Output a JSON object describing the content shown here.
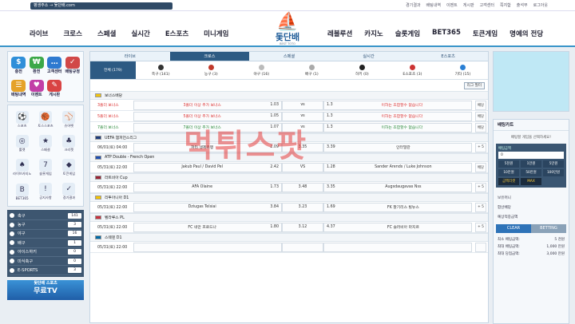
{
  "address": "평생주소 → 돛단배.com",
  "toplinks": [
    "경기결과",
    "배팅내역",
    "이벤트",
    "게시판",
    "고객센터",
    "쪽지함",
    "출석부",
    "로그아웃"
  ],
  "nav_left": [
    "라이브",
    "크로스",
    "스페셜",
    "실시간",
    "E스포츠",
    "미니게임"
  ],
  "nav_right": [
    "레블루션",
    "카지노",
    "슬롯게임",
    "BET365",
    "토큰게임",
    "명예의 전당"
  ],
  "logo": {
    "title": "돛단배",
    "sub": "BEST TOTO"
  },
  "quick": [
    {
      "label": "충전",
      "icon": "$",
      "color": "#2f8fd9"
    },
    {
      "label": "환전",
      "icon": "₩",
      "color": "#3ca848"
    },
    {
      "label": "고객센터",
      "icon": "…",
      "color": "#2f7ad0"
    },
    {
      "label": "배팅규정",
      "icon": "✓",
      "color": "#d14848"
    },
    {
      "label": "배팅내역",
      "icon": "☰",
      "color": "#e5a229"
    },
    {
      "label": "이벤트",
      "icon": "♥",
      "color": "#c23fa7"
    },
    {
      "label": "게시판",
      "icon": "✎",
      "color": "#d94444"
    }
  ],
  "sport_icons": [
    {
      "label": "스포츠",
      "icon": "⚽"
    },
    {
      "label": "토스스포츠",
      "icon": "🏀"
    },
    {
      "label": "슈어벳",
      "icon": "⚾"
    },
    {
      "label": "룰렛",
      "icon": "◎"
    },
    {
      "label": "스페셜",
      "icon": "★"
    },
    {
      "label": "크리켓",
      "icon": "♣"
    },
    {
      "label": "라이브카지노",
      "icon": "♠"
    },
    {
      "label": "슬롯게임",
      "icon": "7"
    },
    {
      "label": "토큰게임",
      "icon": "◆"
    },
    {
      "label": "BET365",
      "icon": "B"
    },
    {
      "label": "공지사항",
      "icon": "!"
    },
    {
      "label": "경기결과",
      "icon": "✓"
    }
  ],
  "counts": [
    {
      "name": "축구",
      "n": "141"
    },
    {
      "name": "농구",
      "n": "3"
    },
    {
      "name": "야구",
      "n": "16"
    },
    {
      "name": "배구",
      "n": "1"
    },
    {
      "name": "아이스하키",
      "n": "0"
    },
    {
      "name": "미식축구",
      "n": "0"
    },
    {
      "name": "E-SPORTS",
      "n": "3"
    }
  ],
  "banner": {
    "top": "돛단배 스포츠",
    "main": "무료TV"
  },
  "tabs": [
    "라이브",
    "크로스",
    "스페셜",
    "실시간",
    "E스포츠"
  ],
  "sports": [
    {
      "label": "전체 (179)",
      "color": "#fff"
    },
    {
      "label": "축구 (141)",
      "color": "#333"
    },
    {
      "label": "농구 (3)",
      "color": "#c0392b"
    },
    {
      "label": "야구 (16)",
      "color": "#bbb"
    },
    {
      "label": "배구 (1)",
      "color": "#aaa"
    },
    {
      "label": "하키 (0)",
      "color": "#222"
    },
    {
      "label": "E스포츠 (3)",
      "color": "#c33"
    },
    {
      "label": "기타 (15)",
      "color": "#2a7fd4"
    }
  ],
  "filter_label": "리그 필터",
  "sections": [
    {
      "league": "보너스배당",
      "flag": "#f1c40f",
      "rows": [
        {
          "time": "3폴더 보너스",
          "home": "3폴더 이상 추가 보너스",
          "ho": "1.03",
          "mid": "vs",
          "ao": "1.3",
          "away": "이하는 조합할수 없습니다",
          "x": "배당",
          "red": true
        },
        {
          "time": "5폴더 보너스",
          "home": "5폴더 이상 추가 보너스",
          "ho": "1.05",
          "mid": "vs",
          "ao": "1.3",
          "away": "이하는 조합할수 없습니다",
          "x": "배당",
          "red": true
        },
        {
          "time": "7폴더 보너스",
          "home": "7폴더 이상 추가 보너스",
          "ho": "1.07",
          "mid": "vs",
          "ao": "1.3",
          "away": "이하는 조합할수 없습니다",
          "x": "배당",
          "green": true
        }
      ]
    },
    {
      "league": "UEFA 챔피언스리그",
      "flag": "#1f3d7a",
      "rows": [
        {
          "time": "06/01(토) 04:00",
          "home": "파리 생제르맹",
          "ho": "2.09",
          "mid": "3.35",
          "ao": "3.39",
          "away": "인터밀란",
          "x": "+ 5"
        }
      ]
    },
    {
      "league": "ATP Double - French Open",
      "flag": "#1f4fb0",
      "rows": [
        {
          "time": "05/31(토) 22:00",
          "home": "Jakub Paul / David Pel",
          "ho": "2.42",
          "mid": "VS",
          "ao": "1.28",
          "away": "Sander Arends / Luke Johnson",
          "x": "배당"
        }
      ]
    },
    {
      "league": "라트비아 Cup",
      "flag": "#9b2335",
      "rows": [
        {
          "time": "05/31(토) 22:00",
          "home": "AFA Olaine",
          "ho": "1.73",
          "mid": "3.48",
          "ao": "3.35",
          "away": "Augsdaugavas Nss",
          "x": "+ 5"
        }
      ]
    },
    {
      "league": "리투아니아 D1",
      "flag": "#f4c300",
      "rows": [
        {
          "time": "05/31(토) 22:00",
          "home": "Dziugas Telsiai",
          "ho": "3.84",
          "mid": "3.23",
          "ao": "1.69",
          "away": "FK 잘기리스 빌뉴스",
          "x": "+ 5"
        }
      ]
    },
    {
      "league": "벨라루스 PL",
      "flag": "#c8313e",
      "rows": [
        {
          "time": "05/31(토) 22:00",
          "home": "FC 네만 흐로드나",
          "ho": "1.80",
          "mid": "3.12",
          "ao": "4.37",
          "away": "FC 슬러비아 마지르",
          "x": "+ 5"
        }
      ]
    },
    {
      "league": "스웨덴 D1",
      "flag": "#006aa7",
      "rows": [
        {
          "time": "05/31(토) 22:00",
          "home": "",
          "ho": "",
          "mid": "",
          "ao": "",
          "away": "",
          "x": ""
        }
      ]
    }
  ],
  "cart": {
    "title": "배팅카트",
    "message": "배팅할 게임을 선택하세요!",
    "select_label": "배팅금액",
    "odds_label": "0",
    "keys": [
      "5천원",
      "1만원",
      "5만원",
      "10만원",
      "50만원",
      "100만원"
    ],
    "reset": "금액리셋",
    "max": "MAX",
    "lines": [
      "보유머니",
      "합산배당",
      "예상적중금액"
    ],
    "clear": "CLEAR",
    "bet": "BETTING",
    "stats": [
      {
        "k": "최소 배팅금액:",
        "v": "5 천원"
      },
      {
        "k": "최대 배팅금액:",
        "v": "1,000 만원"
      },
      {
        "k": "최대 당첨금액:",
        "v": "3,000 만원"
      }
    ]
  },
  "watermark": "먹튀스팟"
}
